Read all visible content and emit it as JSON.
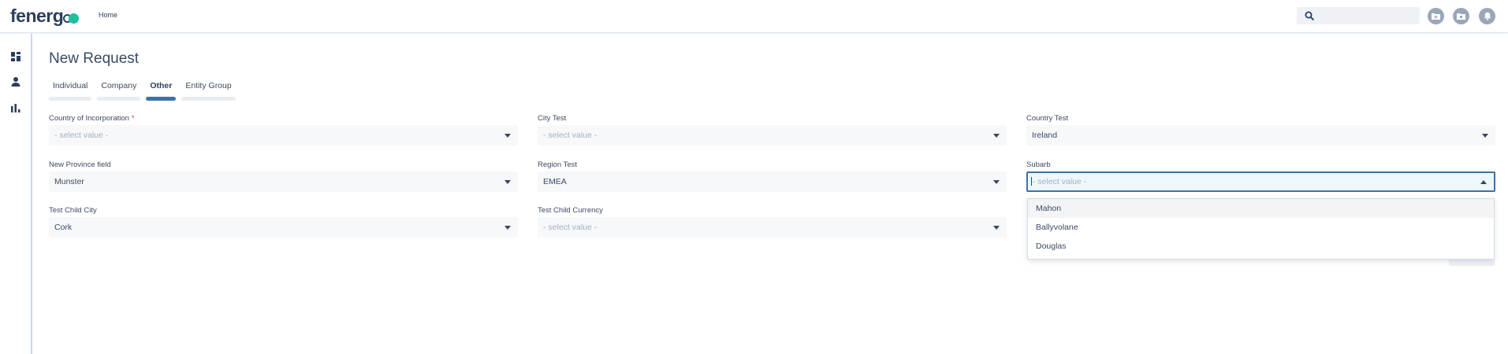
{
  "header": {
    "logo_text": "fenerg",
    "home_label": "Home",
    "search_placeholder": "",
    "icons": [
      "add-folder-icon",
      "new-folder-icon",
      "bell-icon"
    ]
  },
  "sidebar": {
    "icons": [
      "dashboard-icon",
      "user-icon",
      "bar-chart-icon"
    ]
  },
  "page": {
    "title": "New Request",
    "tabs": [
      {
        "label": "Individual",
        "active": false
      },
      {
        "label": "Company",
        "active": false
      },
      {
        "label": "Other",
        "active": true
      },
      {
        "label": "Entity Group",
        "active": false
      }
    ]
  },
  "form": {
    "country_of_incorporation": {
      "label": "Country of Incorporation",
      "required_mark": "*",
      "value": "- select value -"
    },
    "city_test": {
      "label": "City Test",
      "value": "- select value -"
    },
    "country_test": {
      "label": "Country Test",
      "value": "Ireland"
    },
    "new_province_field": {
      "label": "New Province field",
      "value": "Munster"
    },
    "region_test": {
      "label": "Region Test",
      "value": "EMEA"
    },
    "subarb": {
      "label": "Subarb",
      "value": "- select value -"
    },
    "test_child_city": {
      "label": "Test Child City",
      "value": "Cork"
    },
    "test_child_currency": {
      "label": "Test Child Currency",
      "value": "- select value -"
    }
  },
  "subarb_dropdown": {
    "options": [
      "Mahon",
      "Ballyvolane",
      "Douglas"
    ],
    "highlighted": "Mahon"
  },
  "colors": {
    "accent": "#3d72a4",
    "brand_dot": "#1fbf9f",
    "required": "#d9353c"
  }
}
